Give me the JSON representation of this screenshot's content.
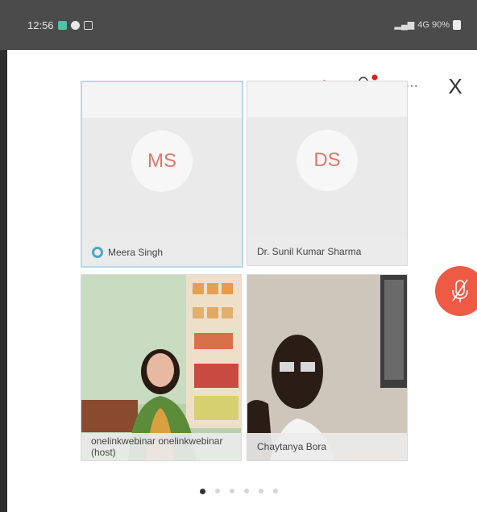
{
  "status_bar": {
    "time": "12:56",
    "right_text": "4G 90%"
  },
  "toolbar": {
    "video_icon": "video-off-icon",
    "participants_icon": "participants-icon",
    "more_label": "···",
    "close_label": "X"
  },
  "tiles": [
    {
      "initials": "MS",
      "name": "Meera Singh",
      "active": true
    },
    {
      "initials": "DS",
      "name": "Dr. Sunil Kumar Sharma",
      "active": false
    },
    {
      "name": "onelinkwebinar onelinkwebinar (host)",
      "video": true
    },
    {
      "name": "Chaytanya Bora",
      "video": true
    }
  ],
  "mic_fab": {
    "icon": "mic-off-icon",
    "color": "#ee5a44"
  },
  "pager": {
    "count": 6,
    "active_index": 0
  },
  "colors": {
    "status_bar": "#4b4b4b",
    "accent": "#ee5a44",
    "initials": "#e0776a"
  }
}
